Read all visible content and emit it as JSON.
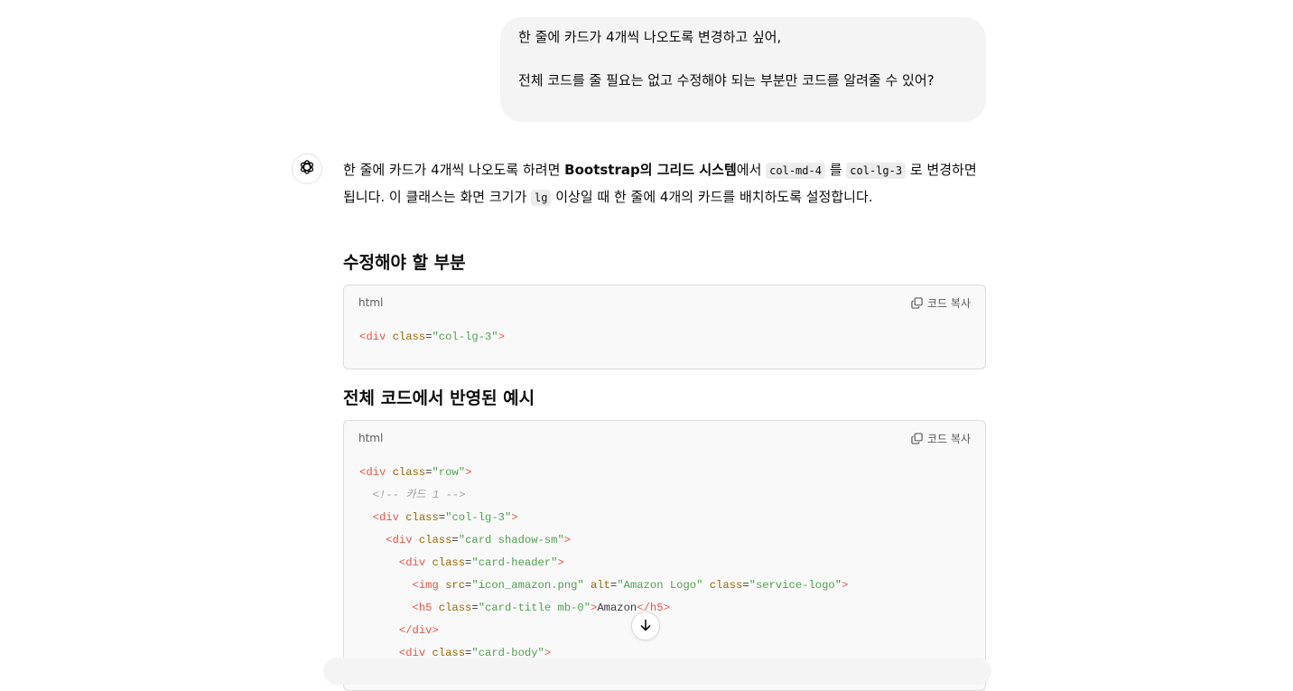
{
  "user_message": {
    "line1": "한 줄에 카드가 4개씩 나오도록 변경하고 싶어,",
    "line2": "전체 코드를 줄 필요는 없고 수정해야 되는 부분만 코드를 알려줄 수 있어?"
  },
  "assistant": {
    "avatar_icon": "openai-logo-icon",
    "intro_1": "한 줄에 카드가 4개씩 나오도록 하려면 ",
    "intro_bold": "Bootstrap의 그리드 시스템",
    "intro_2": "에서 ",
    "code_a": "col-md-4",
    "intro_3": " 를 ",
    "code_b": "col-lg-3",
    "intro_4": " 로 변경하면 됩니다. 이 클래스는 화면 크기가 ",
    "code_c": "lg",
    "intro_5": " 이상일 때 한 줄에 4개의 카드를 배치하도록 설정합니다.",
    "heading_1": "수정해야 할 부분",
    "heading_2": "전체 코드에서 반영된 예시",
    "code_lang": "html",
    "copy_label": "코드 복사",
    "copy_icon": "copy-icon",
    "snippet_1": [
      [
        [
          "tag",
          "<div "
        ],
        [
          "attr",
          "class"
        ],
        [
          "txt",
          "="
        ],
        [
          "str",
          "\"col-lg-3\""
        ],
        [
          "tag",
          ">"
        ]
      ]
    ],
    "snippet_2": [
      [
        [
          "tag",
          "<div "
        ],
        [
          "attr",
          "class"
        ],
        [
          "txt",
          "="
        ],
        [
          "str",
          "\"row\""
        ],
        [
          "tag",
          ">"
        ]
      ],
      [
        [
          "txt",
          "  "
        ],
        [
          "com",
          "<!-- 카드 1 -->"
        ]
      ],
      [
        [
          "txt",
          "  "
        ],
        [
          "tag",
          "<div "
        ],
        [
          "attr",
          "class"
        ],
        [
          "txt",
          "="
        ],
        [
          "str",
          "\"col-lg-3\""
        ],
        [
          "tag",
          ">"
        ]
      ],
      [
        [
          "txt",
          "    "
        ],
        [
          "tag",
          "<div "
        ],
        [
          "attr",
          "class"
        ],
        [
          "txt",
          "="
        ],
        [
          "str",
          "\"card shadow-sm\""
        ],
        [
          "tag",
          ">"
        ]
      ],
      [
        [
          "txt",
          "      "
        ],
        [
          "tag",
          "<div "
        ],
        [
          "attr",
          "class"
        ],
        [
          "txt",
          "="
        ],
        [
          "str",
          "\"card-header\""
        ],
        [
          "tag",
          ">"
        ]
      ],
      [
        [
          "txt",
          "        "
        ],
        [
          "tag",
          "<img "
        ],
        [
          "attr",
          "src"
        ],
        [
          "txt",
          "="
        ],
        [
          "str",
          "\"icon_amazon.png\""
        ],
        [
          "txt",
          " "
        ],
        [
          "attr",
          "alt"
        ],
        [
          "txt",
          "="
        ],
        [
          "str",
          "\"Amazon Logo\""
        ],
        [
          "txt",
          " "
        ],
        [
          "attr",
          "class"
        ],
        [
          "txt",
          "="
        ],
        [
          "str",
          "\"service-logo\""
        ],
        [
          "tag",
          ">"
        ]
      ],
      [
        [
          "txt",
          "        "
        ],
        [
          "tag",
          "<h5 "
        ],
        [
          "attr",
          "class"
        ],
        [
          "txt",
          "="
        ],
        [
          "str",
          "\"card-title mb-0\""
        ],
        [
          "tag",
          ">"
        ],
        [
          "txt",
          "Amazon"
        ],
        [
          "tag",
          "</h5>"
        ]
      ],
      [
        [
          "txt",
          "      "
        ],
        [
          "tag",
          "</div>"
        ]
      ],
      [
        [
          "txt",
          "      "
        ],
        [
          "tag",
          "<div "
        ],
        [
          "attr",
          "class"
        ],
        [
          "txt",
          "="
        ],
        [
          "str",
          "\"card-body\""
        ],
        [
          "tag",
          ">"
        ]
      ]
    ]
  },
  "scroll_button": {
    "icon": "arrow-down-icon"
  },
  "colors": {
    "tag": "#e45649",
    "attr": "#986801",
    "string": "#50a14f",
    "comment": "#a0a1a7",
    "bubble_bg": "#f4f4f4",
    "code_bg": "#f9f9f9"
  }
}
